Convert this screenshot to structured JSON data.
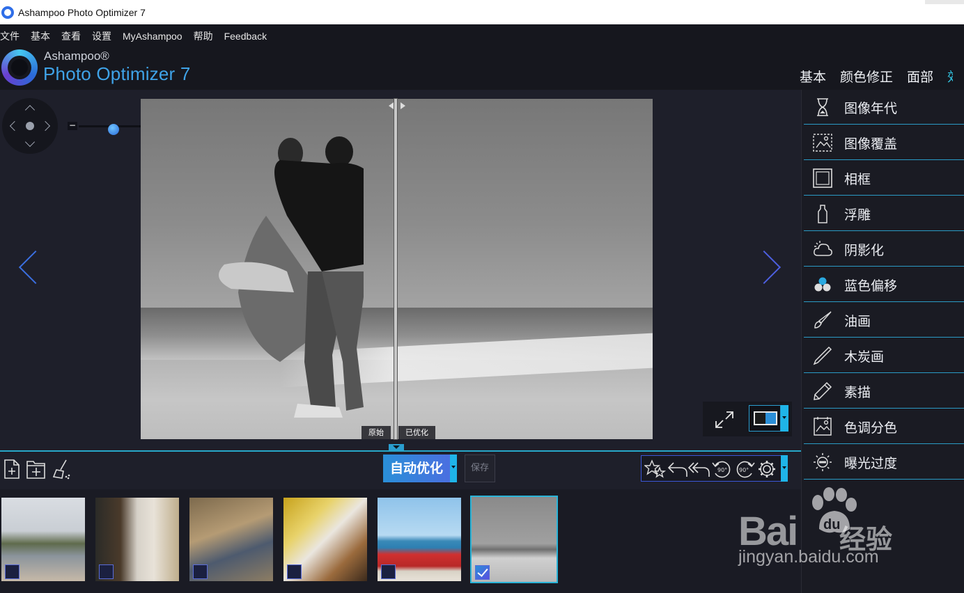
{
  "window": {
    "title": "Ashampoo Photo Optimizer 7"
  },
  "menu": [
    "文件",
    "基本",
    "查看",
    "设置",
    "MyAshampoo",
    "帮助",
    "Feedback"
  ],
  "brand": {
    "top": "Ashampoo®",
    "main": "Photo Optimizer 7"
  },
  "top_tabs": [
    "基本",
    "颜色修正",
    "面部",
    "效"
  ],
  "zoom": {
    "minus": "−",
    "plus": "+",
    "level": 0.4
  },
  "compare": {
    "original": "原始",
    "optimized": "已优化"
  },
  "toolbar": {
    "auto_optimize": "自动优化",
    "save": "保存",
    "rotate_left": "90°",
    "rotate_right": "90°"
  },
  "panel_items": [
    {
      "label": "图像年代",
      "icon": "hourglass-icon"
    },
    {
      "label": "图像覆盖",
      "icon": "image-overlay-icon"
    },
    {
      "label": "相框",
      "icon": "frame-icon"
    },
    {
      "label": "浮雕",
      "icon": "emboss-icon"
    },
    {
      "label": "阴影化",
      "icon": "shadow-icon"
    },
    {
      "label": "蓝色偏移",
      "icon": "blue-shift-icon"
    },
    {
      "label": "油画",
      "icon": "oil-paint-brush-icon"
    },
    {
      "label": "木炭画",
      "icon": "charcoal-icon"
    },
    {
      "label": "素描",
      "icon": "sketch-pencil-icon"
    },
    {
      "label": "色调分色",
      "icon": "posterize-icon"
    },
    {
      "label": "曝光过度",
      "icon": "overexposure-icon"
    }
  ],
  "thumbnails": [
    {
      "name": "lake-landscape",
      "checked": false
    },
    {
      "name": "kitchen-woman",
      "checked": false
    },
    {
      "name": "couple-ruins",
      "checked": false
    },
    {
      "name": "cake-decorating",
      "checked": false
    },
    {
      "name": "red-car-beach",
      "checked": false
    },
    {
      "name": "couple-beach-bw",
      "checked": true
    }
  ],
  "watermark": {
    "logo": "Bai",
    "paw": "du",
    "cn": "经验",
    "url": "jingyan.baidu.com"
  },
  "colors": {
    "accent": "#2a9ed0",
    "brand_blue": "#3fa3e8",
    "bg": "#1c1d26"
  }
}
